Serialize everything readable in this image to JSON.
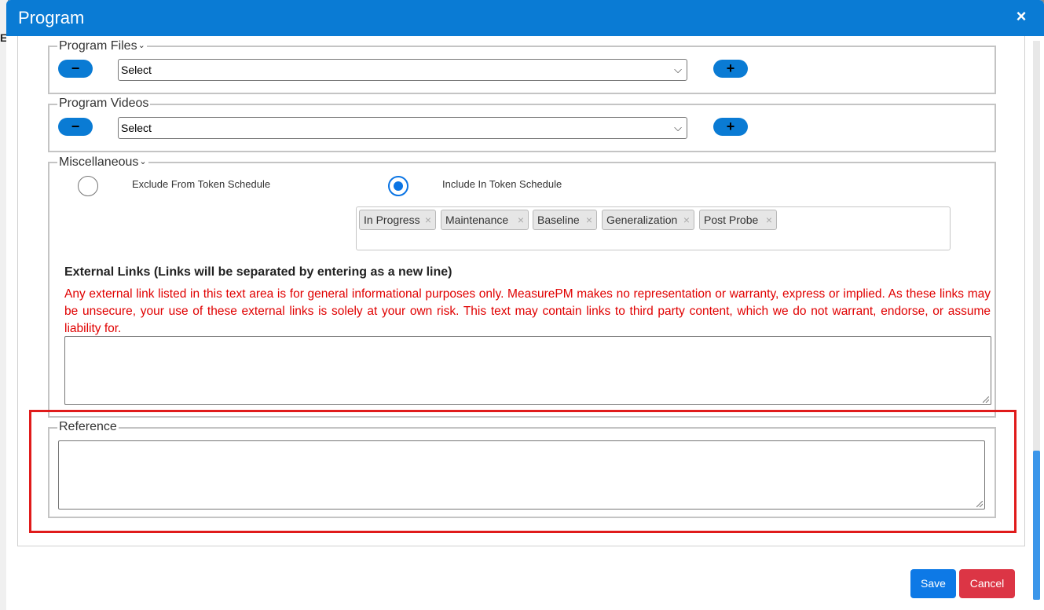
{
  "background": {
    "partial_letter": "E"
  },
  "modal": {
    "title": "Program",
    "close_glyph": "×"
  },
  "program_files": {
    "legend": "Program Files",
    "chevron": "⌄",
    "remove_glyph": "−",
    "add_glyph": "+",
    "select_value": "Select"
  },
  "program_videos": {
    "legend": "Program Videos",
    "remove_glyph": "−",
    "add_glyph": "+",
    "select_value": "Select"
  },
  "miscellaneous": {
    "legend": "Miscellaneous",
    "chevron": "⌄",
    "radio_exclude": {
      "label": "Exclude From Token Schedule",
      "checked": false
    },
    "radio_include": {
      "label": "Include In Token Schedule",
      "checked": true
    },
    "tags": [
      "In Progress",
      "Maintenance",
      "Baseline",
      "Generalization",
      "Post Probe"
    ],
    "tag_remove_glyph": "×",
    "external_links_title": "External Links (Links will be separated by entering as a new line)",
    "disclaimer": "Any external link listed in this text area is for general informational purposes only. MeasurePM makes no representation or warranty, express or implied. As these links may be unsecure, your use of these external links is solely at your own risk. This text may contain links to third party content, which we do not warrant, endorse, or assume liability for.",
    "external_links_value": ""
  },
  "reference": {
    "legend": "Reference",
    "value": ""
  },
  "footer": {
    "save_label": "Save",
    "cancel_label": "Cancel"
  },
  "colors": {
    "header": "#0a7bd4",
    "pill_button": "#0a7bd4",
    "disclaimer_text": "#e00000",
    "highlight_border": "#e01b1b",
    "save_button": "#0d79e6",
    "cancel_button": "#dc3545"
  },
  "icons": {
    "close": "close-icon",
    "remove": "minus-icon",
    "add": "plus-icon",
    "select": "chevron-down-icon",
    "tag_remove": "tag-close-icon"
  }
}
